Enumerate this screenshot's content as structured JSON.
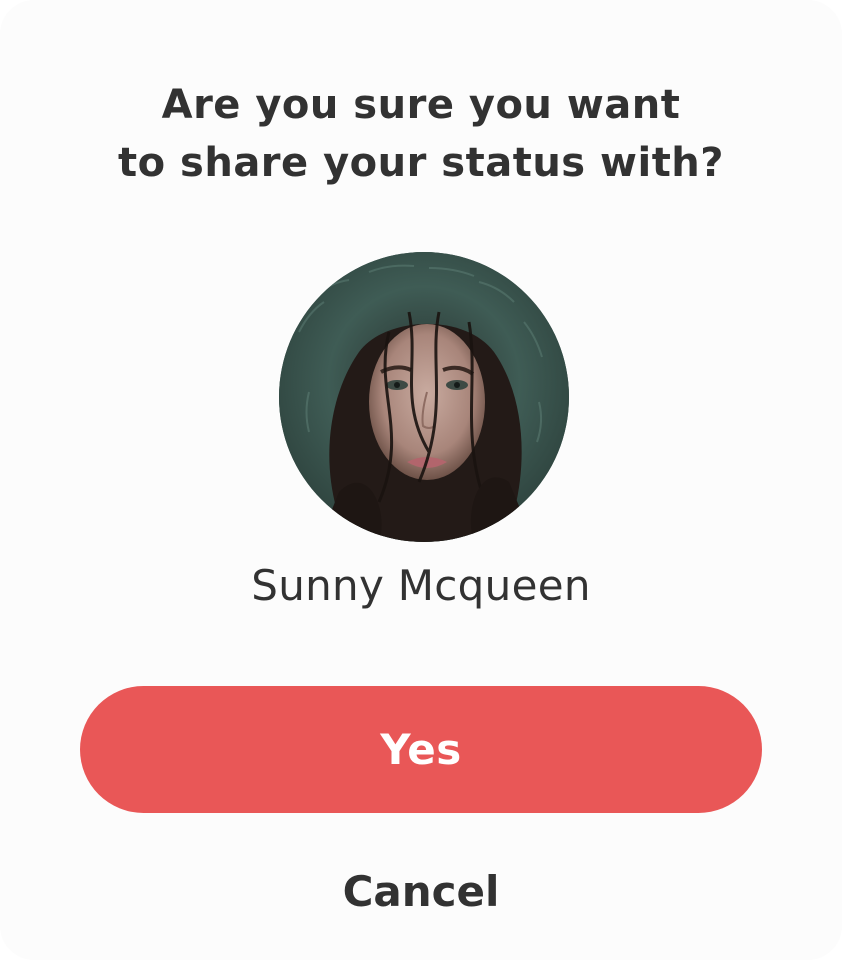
{
  "dialog": {
    "title_line1": "Are you sure you want",
    "title_line2": "to share your status with?",
    "contact": {
      "name": "Sunny Mcqueen",
      "avatar_alt": "Sunny Mcqueen"
    },
    "confirm_label": "Yes",
    "cancel_label": "Cancel"
  },
  "colors": {
    "confirm_button": "#e95757",
    "text": "#323232",
    "background": "#fcfcfc"
  }
}
